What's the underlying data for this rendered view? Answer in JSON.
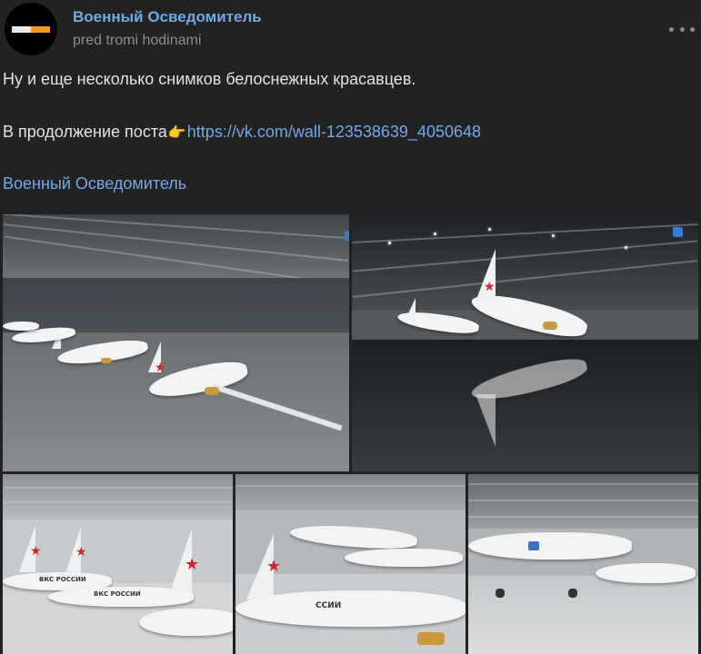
{
  "post": {
    "author": "Военный Осведомитель",
    "time": "pred tromi hodinami",
    "text": {
      "line1": "Ну и еще несколько снимков белоснежных красавцев.",
      "line2_prefix": "В продолжение поста",
      "line2_emoji": "👉",
      "line2_link": "https://vk.com/wall-123538639_4050648",
      "line3_link": "Военный Осведомитель"
    }
  },
  "photos": [
    {
      "name": "photo-hangar-row",
      "alt": ""
    },
    {
      "name": "photo-hangar-reflection",
      "alt": ""
    },
    {
      "name": "photo-tails-closeup",
      "alt": ""
    },
    {
      "name": "photo-nose-closeup",
      "alt": ""
    },
    {
      "name": "photo-side-view",
      "alt": ""
    }
  ],
  "aircraft_markings": {
    "vks": "ВКС РОССИИ",
    "partial": "ССИИ"
  },
  "colors": {
    "background": "#222222",
    "link": "#71aaeb",
    "text": "#e1e3e6",
    "muted": "#8a8d92",
    "star_red": "#d2262a"
  },
  "icons": {
    "more": "more-horizontal-icon",
    "avatar_logo": "military-informant-logo"
  }
}
